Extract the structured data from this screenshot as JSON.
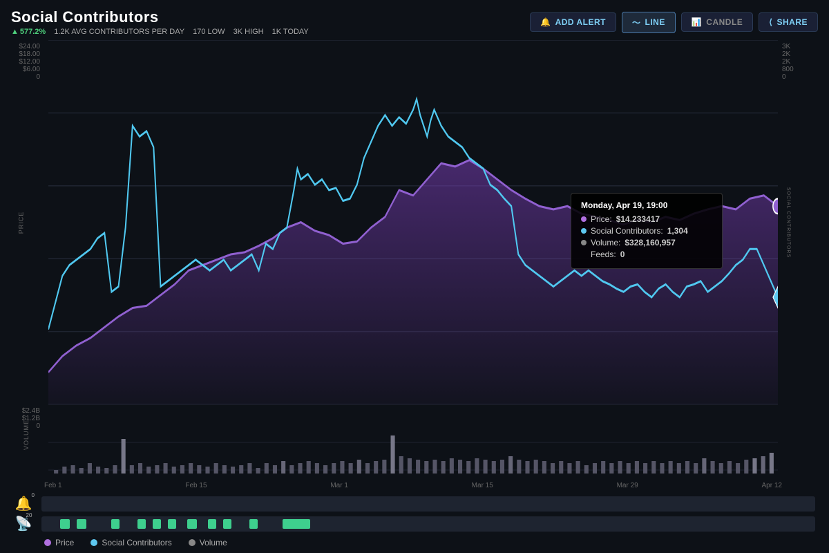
{
  "header": {
    "title": "Social Contributors",
    "stats": {
      "change": "577.2%",
      "avg": "1.2K AVG CONTRIBUTORS PER DAY",
      "low": "170 LOW",
      "high": "3K HIGH",
      "today": "1K TODAY"
    },
    "buttons": {
      "alert": "ADD ALERT",
      "line": "LINE",
      "candle": "CANDLE",
      "share": "SHARE"
    }
  },
  "yAxisLeft": {
    "labels": [
      "$24.00",
      "$18.00",
      "$12.00",
      "$6.00",
      "0"
    ],
    "axisLabel": "PRICE"
  },
  "yAxisRight": {
    "labels": [
      "3K",
      "2K",
      "2K",
      "800",
      "0"
    ],
    "axisLabel": "SOCIAL CONTRIBUTORS"
  },
  "volumeAxis": {
    "labels": [
      "$2.4B",
      "$1.2B",
      "0"
    ]
  },
  "xAxisLabels": [
    "Feb 1",
    "Feb 15",
    "Mar 1",
    "Mar 15",
    "Mar 29",
    "Apr 12"
  ],
  "tooltip": {
    "title": "Monday, Apr 19, 19:00",
    "price_label": "Price:",
    "price_value": "$14.233417",
    "contributors_label": "Social Contributors:",
    "contributors_value": "1,304",
    "volume_label": "Volume:",
    "volume_value": "$328,160,957",
    "feeds_label": "Feeds:",
    "feeds_value": "0"
  },
  "legend": {
    "price": "Price",
    "contributors": "Social Contributors",
    "volume": "Volume"
  },
  "colors": {
    "price": "#b070e0",
    "contributors": "#5ec8f0",
    "volume": "#888",
    "green": "#3ecf8e",
    "background": "#0d1117"
  },
  "alertBar": {
    "badge": "0"
  },
  "feedsBar": {
    "badge": "20"
  }
}
